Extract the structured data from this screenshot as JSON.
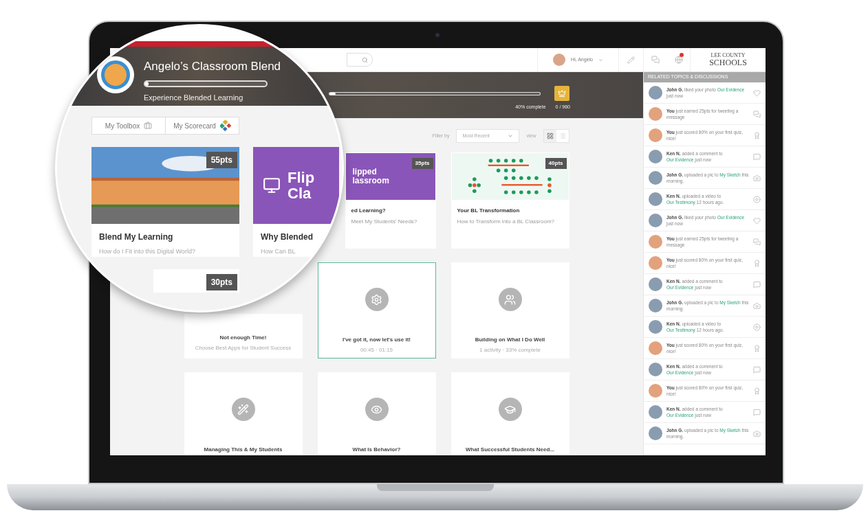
{
  "magnifier": {
    "title": "Angelo’s Classroom Blend",
    "subtitle": "Experience Blended Learning",
    "progress": {
      "level": 0.03
    },
    "buttons": [
      {
        "label": "My Toolbox"
      },
      {
        "label": "My Scorecard"
      }
    ],
    "cards": [
      {
        "kind": "photo",
        "points": "55pts",
        "title": "Blend My Learning",
        "subtitle": "How do I Fit into this Digital World?"
      },
      {
        "kind": "flipped",
        "image_text": [
          "Flip",
          "Cla"
        ],
        "title": "Why Blended",
        "subtitle": "How Can BL"
      },
      {
        "kind": "points",
        "points": "30pts"
      }
    ]
  },
  "header": {
    "greeting": "Hi, Angelo",
    "logo": {
      "top": "LEE COUNTY",
      "bottom": "SCHOOLS"
    }
  },
  "banner": {
    "progress": {
      "level": 0.03
    },
    "percent": "40% complete",
    "points": "0 / 960"
  },
  "filter": {
    "label": "Filter by",
    "value": "Most Recent",
    "view_label": "view",
    "views": [
      {
        "kind": "grid",
        "selected": true
      },
      {
        "kind": "list",
        "selected": false
      }
    ]
  },
  "cards": [
    {
      "kind": "image",
      "points": "35pts",
      "image_text": [
        "lipped",
        "lassroom"
      ],
      "title": "ed Learning?",
      "subtitle": "Meet My Students' Needs?",
      "selected": false
    },
    {
      "kind": "image",
      "points": "40pts",
      "title": "Your BL Transformation",
      "subtitle": "How to Transform into a BL Classroom?",
      "selected": false
    },
    {
      "kind": "activity",
      "title": "Not enough Time!",
      "subtitle": "Choose Best Apps for Student Success",
      "selected": false
    },
    {
      "kind": "activity",
      "title": "I've got it, now let's use it!",
      "subtitle": "00:45 · 01:15",
      "selected": true
    },
    {
      "kind": "activity",
      "title": "Building on What I Do Well",
      "subtitle": "1 activity · 33% complete",
      "selected": false
    },
    {
      "kind": "activity",
      "title": "Managing This & My Students",
      "selected": false
    },
    {
      "kind": "activity",
      "title": "What Is Behavior?",
      "selected": false
    },
    {
      "kind": "activity",
      "title": "What Successful Students Need...",
      "selected": false
    }
  ],
  "sidebar": {
    "title": "RELATED TOPICS & DISCUSSIONS",
    "items": [
      {
        "actor": "John G.",
        "text": "liked your photo",
        "link": "Our Evidence",
        "tail": "just now",
        "kind": "like"
      },
      {
        "actor": "You",
        "text": "just earned 25pts for tweeting a message",
        "kind": "tweet"
      },
      {
        "actor": "You",
        "text": "just scored 80% on your first quiz, nice!",
        "kind": "score"
      },
      {
        "actor": "Ken N.",
        "text": "added a comment to",
        "link": "Our Evidence",
        "tail": "just now",
        "kind": "comment"
      },
      {
        "actor": "John G.",
        "text": "uploaded a pic to",
        "link": "My Sketch",
        "tail": "this morning.",
        "kind": "photo"
      },
      {
        "actor": "Ken N.",
        "text": "uploaded a video to",
        "link": "Our Testimony",
        "tail": "12 hours ago.",
        "kind": "video"
      },
      {
        "actor": "John G.",
        "text": "liked your photo",
        "link": "Our Evidence",
        "tail": "just now",
        "kind": "like"
      },
      {
        "actor": "You",
        "text": "just earned 25pts for tweeting a message",
        "kind": "tweet"
      },
      {
        "actor": "You",
        "text": "just scored 80% on your first quiz, nice!",
        "kind": "score"
      },
      {
        "actor": "Ken N.",
        "text": "added a comment to",
        "link": "Our Evidence",
        "tail": "just now",
        "kind": "comment"
      },
      {
        "actor": "John G.",
        "text": "uploaded a pic to",
        "link": "My Sketch",
        "tail": "this morning.",
        "kind": "photo"
      },
      {
        "actor": "Ken N.",
        "text": "uploaded a video to",
        "link": "Our Testimony",
        "tail": "12 hours ago.",
        "kind": "video"
      },
      {
        "actor": "You",
        "text": "just scored 80% on your first quiz, nice!",
        "kind": "score"
      },
      {
        "actor": "Ken N.",
        "text": "added a comment to",
        "link": "Our Evidence",
        "tail": "just now",
        "kind": "comment"
      },
      {
        "actor": "You",
        "text": "just scored 80% on your first quiz, nice!",
        "kind": "score"
      },
      {
        "actor": "Ken N.",
        "text": "added a comment to",
        "link": "Our Evidence",
        "tail": "just now",
        "kind": "comment"
      },
      {
        "actor": "John G.",
        "text": "uploaded a pic to",
        "link": "My Sketch",
        "tail": "this morning.",
        "kind": "photo"
      }
    ]
  }
}
